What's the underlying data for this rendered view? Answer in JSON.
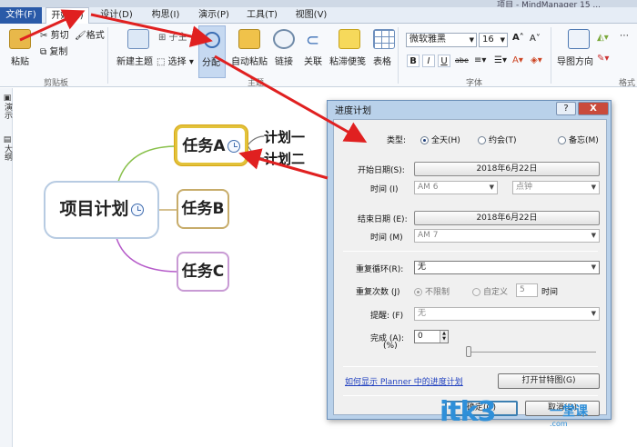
{
  "window": {
    "title_fragment": "项目 - MindManager 15 ..."
  },
  "ribbon_tabs": [
    "文件(F)",
    "开始(H)",
    "设计(D)",
    "构思(I)",
    "演示(P)",
    "工具(T)",
    "视图(V)"
  ],
  "ribbon": {
    "paste": "粘贴",
    "cut": "剪切",
    "copy": "复制",
    "format": "格式",
    "clipboard_group": "剪贴板",
    "new_topic": "新建主题",
    "choose": "选择",
    "assign": "分配",
    "auto_paste": "自动粘贴",
    "link": "链接",
    "relation": "关联",
    "sticky_paste": "粘滞便笺",
    "table": "表格",
    "topic_group": "主题",
    "font_name": "微软雅黑",
    "font_size": "16",
    "font_group": "字体",
    "map_direction": "导图方向",
    "style_group": "格式"
  },
  "side_panel": {
    "present": "演示",
    "outline": "大纲"
  },
  "mindmap": {
    "central": "项目计划",
    "task_a": "任务A",
    "task_b": "任务B",
    "task_c": "任务C",
    "plan_1": "计划一",
    "plan_2": "计划二"
  },
  "dialog": {
    "title": "进度计划",
    "help": "?",
    "close": "X",
    "type_label": "类型:",
    "type_options": [
      "全天(H)",
      "约会(T)",
      "备忘(M)"
    ],
    "type_selected": "全天(H)",
    "start_date_label": "开始日期(S):",
    "start_date": "2018年6月22日",
    "start_time_label": "时间 (I)",
    "start_time": "AM 6",
    "start_unit": "点钟",
    "end_date_label": "结束日期 (E):",
    "end_date": "2018年6月22日",
    "end_time_label": "时间 (M)",
    "end_time": "AM 7",
    "repeat_label": "重复循环(R):",
    "repeat_value": "无",
    "repeat_count_label": "重复次数 (J)",
    "unlimited": "不限制",
    "custom": "自定义",
    "custom_count": "5",
    "custom_unit": "时间",
    "reminder_label": "提醒: (F)",
    "reminder_value": "无",
    "complete_label": "完成 (A):",
    "complete_unit": "(%)",
    "complete_value": "0",
    "help_link": "如何显示 Planner 中的进度计划",
    "gantt_button": "打开甘特图(G)",
    "ok_button": "确定(O)",
    "cancel_button": "取消(D)"
  },
  "watermark": {
    "logo": "itk3",
    "cn": "一堂课",
    "url": ".com"
  },
  "colors": {
    "file_tab": "#2a5aa8",
    "arrow": "#e02020",
    "task_a_border": "#e2c23a",
    "task_b_border": "#c7ac6a",
    "task_c_border": "#c89ad4",
    "branch_a": "#88c04a",
    "branch_c": "#b55ac9"
  }
}
